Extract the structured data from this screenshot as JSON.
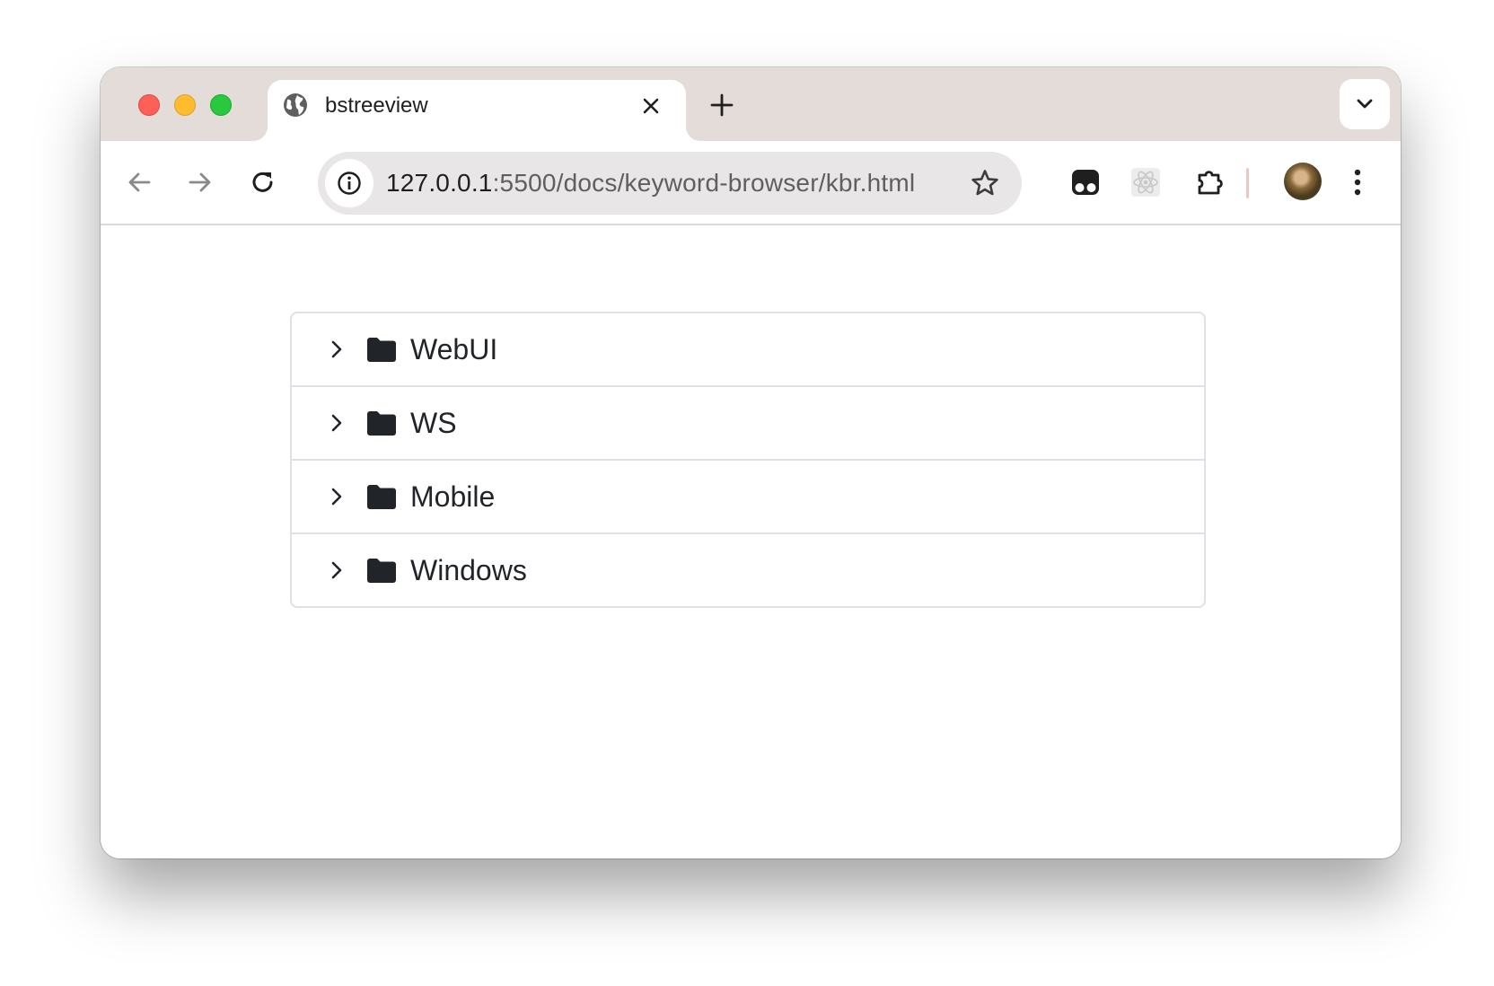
{
  "tab": {
    "title": "bstreeview",
    "favicon": "globe-icon"
  },
  "omnibox": {
    "host": "127.0.0.1",
    "path": ":5500/docs/keyword-browser/kbr.html"
  },
  "toolbar_icons": [
    "back-arrow-icon",
    "forward-arrow-icon",
    "reload-icon",
    "info-icon",
    "star-icon",
    "tampermonkey-icon",
    "react-devtools-icon",
    "extensions-puzzle-icon",
    "profile-avatar",
    "more-vert-icon"
  ],
  "tree": {
    "items": [
      {
        "label": "WebUI",
        "icon": "folder-icon",
        "expander": "chevron-right-icon"
      },
      {
        "label": "WS",
        "icon": "folder-icon",
        "expander": "chevron-right-icon"
      },
      {
        "label": "Mobile",
        "icon": "folder-icon",
        "expander": "chevron-right-icon"
      },
      {
        "label": "Windows",
        "icon": "folder-icon",
        "expander": "chevron-right-icon"
      }
    ]
  },
  "colors": {
    "tabstrip": "#e3dcd9",
    "omnibox": "#e8e6e6",
    "tree_border": "#dee2e6",
    "text": "#212529"
  }
}
